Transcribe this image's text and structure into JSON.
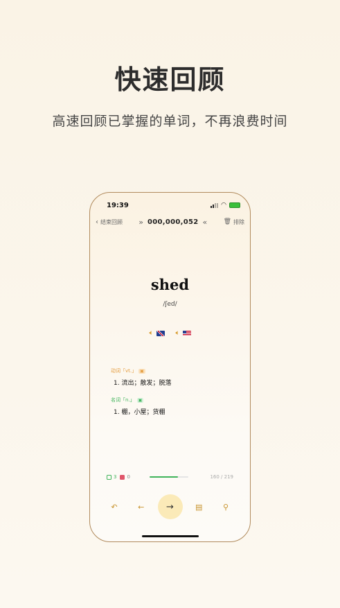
{
  "promo": {
    "headline": "快速回顾",
    "subline": "高速回顾已掌握的单词，不再浪费时间"
  },
  "status_bar": {
    "time": "19:39"
  },
  "topbar": {
    "back_label": "结束回顾",
    "counter": "000,000,052",
    "exclude_label": "排除"
  },
  "word": {
    "text": "shed",
    "phonetic": "/ʃed/"
  },
  "audio": [
    {
      "accent": "UK",
      "icon": "speaker-icon"
    },
    {
      "accent": "US",
      "icon": "speaker-icon"
    }
  ],
  "definitions": [
    {
      "pos": "动词「vt.」",
      "tag": "▣",
      "meaning": "1.  流出；散发；脱落"
    },
    {
      "pos": "名词「n.」",
      "tag": "▣",
      "meaning": "1.  棚，小屋；货棚"
    }
  ],
  "progress": {
    "correct": "3",
    "wrong": "0",
    "fraction": 0.73,
    "pages": "160 / 219"
  },
  "colors": {
    "accent": "#c8932e",
    "correct": "#3fb35a",
    "wrong": "#e0556a"
  }
}
